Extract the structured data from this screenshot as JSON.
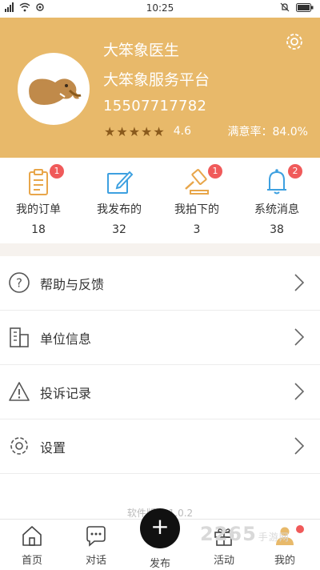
{
  "status_bar": {
    "time": "10:25"
  },
  "profile": {
    "name": "大笨象医生",
    "organization": "大笨象服务平台",
    "phone": "15507717782",
    "stars": "★★★★★",
    "rating": "4.6",
    "satisfaction": "满意率：84.0%"
  },
  "stats": [
    {
      "label": "我的订单",
      "count": "18",
      "badge": "1"
    },
    {
      "label": "我发布的",
      "count": "32",
      "badge": ""
    },
    {
      "label": "我拍下的",
      "count": "3",
      "badge": "1"
    },
    {
      "label": "系统消息",
      "count": "38",
      "badge": "2"
    }
  ],
  "menu": [
    {
      "label": "帮助与反馈",
      "icon": "question-icon"
    },
    {
      "label": "单位信息",
      "icon": "building-icon"
    },
    {
      "label": "投诉记录",
      "icon": "warning-icon"
    },
    {
      "label": "设置",
      "icon": "gear-icon"
    }
  ],
  "version": "软件版本 1.0.2",
  "tabbar": {
    "home": "首页",
    "chat": "对话",
    "publish": "发布",
    "activity": "活动",
    "mine": "我的"
  },
  "colors": {
    "header_bg": "#e8b96a",
    "badge": "#f05a5a",
    "icon_orange": "#e8a64a",
    "icon_blue": "#3da0e0"
  },
  "watermark": {
    "text": "2265",
    "suffix": "手游网"
  }
}
